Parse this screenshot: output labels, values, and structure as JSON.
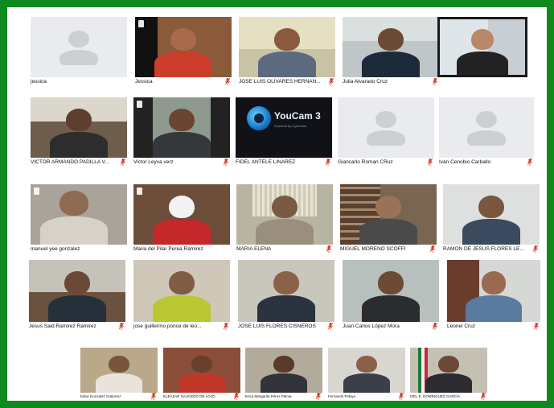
{
  "participants": [
    {
      "name": "jessica",
      "video": false
    },
    {
      "name": "Jessica",
      "video": true
    },
    {
      "name": "JOSE LUIS OLIVARES HERNAN...",
      "video": true
    },
    {
      "name": "Julia Alvarado Cruz",
      "video": true
    },
    {
      "name": "",
      "video": true,
      "highlight": true
    },
    {
      "name": "VICTOR ARMANDO PADILLA V...",
      "video": true
    },
    {
      "name": "Victor Leyva verz",
      "video": true
    },
    {
      "name": "FIDEL ANTELE LINAREZ",
      "video": true,
      "youcam": true
    },
    {
      "name": "Giancarlo Roman CRuz",
      "video": false
    },
    {
      "name": "Iván Cenobio Carballo",
      "video": false
    },
    {
      "name": "manuel yee gonzalez",
      "video": true
    },
    {
      "name": "Maria del Pilar Perea Ramirez",
      "video": true
    },
    {
      "name": "MARIA ELENA",
      "video": true
    },
    {
      "name": "MIGUEL MORENO SCOFFI",
      "video": true
    },
    {
      "name": "RAMON DE JESUS FLORES LE...",
      "video": true
    },
    {
      "name": "Jesus Said Ramirez Ramirez",
      "video": true
    },
    {
      "name": "jose guillermo ponce de leo...",
      "video": true
    },
    {
      "name": "JOSE LUIS FLORES CISNEROS",
      "video": true
    },
    {
      "name": "Juan Carlos López Mora",
      "video": true
    },
    {
      "name": "Leonel Cruz",
      "video": true
    },
    {
      "name": "Edna Gonzalez Gutierrez",
      "video": true
    },
    {
      "name": "ELEAZAR SAUCEDO DE LOJO",
      "video": true
    },
    {
      "name": "Erica Margarita Pérez Palma",
      "video": true
    },
    {
      "name": "Fernando Pelayo",
      "video": true
    },
    {
      "name": "IZEL E. DOMÍNGUEZ GARCÍA",
      "video": true
    }
  ],
  "youcam": {
    "brand": "YouCam 3",
    "tagline": "Powered by CyberLink"
  },
  "colors": {
    "frame": "#0e8a1f",
    "mic_muted": "#d23b2a"
  }
}
